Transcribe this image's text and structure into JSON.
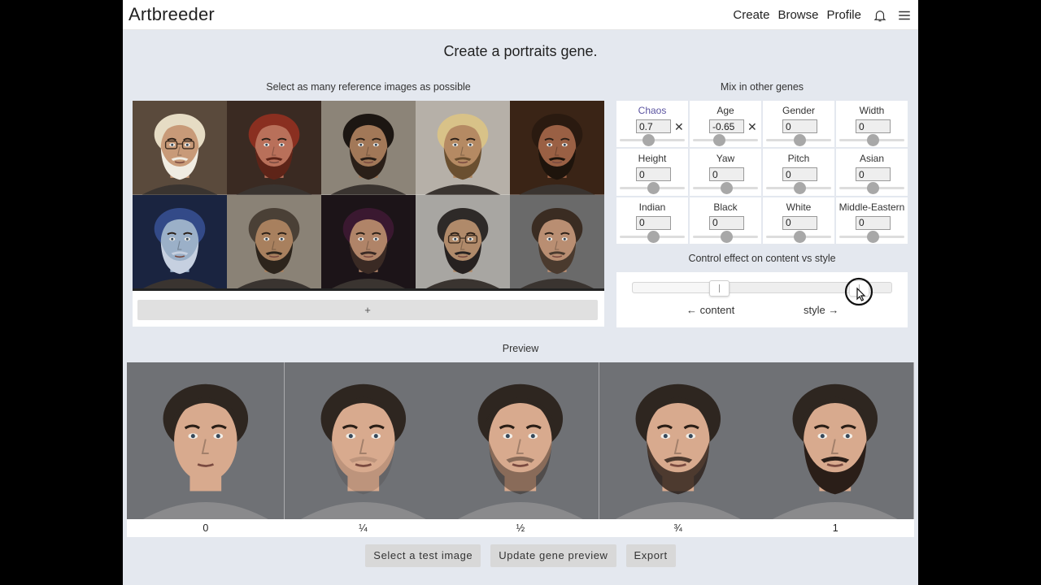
{
  "app": {
    "brand": "Artbreeder"
  },
  "nav": {
    "create": "Create",
    "browse": "Browse",
    "profile": "Profile"
  },
  "page": {
    "title": "Create a portraits gene.",
    "reference_label": "Select as many reference images as possible",
    "mix_label": "Mix in other genes",
    "effect_label": "Control effect on content vs style",
    "preview_label": "Preview"
  },
  "references": {
    "add_label": "+",
    "images": [
      {
        "skin": "#c89a78",
        "hair": "#e6dcc4",
        "beard": "#f0ece2",
        "bg": "#5a4a3c",
        "glasses": true
      },
      {
        "skin": "#b9705a",
        "hair": "#8a2f20",
        "beard": "#5e2418",
        "bg": "#3a2a22",
        "glasses": false
      },
      {
        "skin": "#a27858",
        "hair": "#1c1612",
        "beard": "#2a1f18",
        "bg": "#8c8478",
        "glasses": false
      },
      {
        "skin": "#b58a63",
        "hair": "#d8c288",
        "beard": "#6a4f30",
        "bg": "#b6b0a8",
        "glasses": false
      },
      {
        "skin": "#9a6044",
        "hair": "#2a1a10",
        "beard": "#1e140c",
        "bg": "#3a2416",
        "glasses": false
      },
      {
        "skin": "#9bb0c8",
        "hair": "#334a88",
        "beard": "#c6d0e0",
        "bg": "#1a2440",
        "glasses": false
      },
      {
        "skin": "#a8805e",
        "hair": "#4a4036",
        "beard": "#2c241c",
        "bg": "#8a8276",
        "glasses": false
      },
      {
        "skin": "#b08468",
        "hair": "#3a1830",
        "beard": "#3a2a24",
        "bg": "#1c1418",
        "glasses": false
      },
      {
        "skin": "#b08a6a",
        "hair": "#2e2a28",
        "beard": "#262120",
        "bg": "#a8a6a2",
        "glasses": true
      },
      {
        "skin": "#b98e72",
        "hair": "#3a2c22",
        "beard": "#4a3a2e",
        "bg": "#6a6a6a",
        "glasses": false
      }
    ]
  },
  "genes": [
    {
      "name": "Chaos",
      "value": "0.7",
      "active": true,
      "clearable": true,
      "level": 0.42
    },
    {
      "name": "Age",
      "value": "-0.65",
      "active": false,
      "clearable": true,
      "level": 0.38
    },
    {
      "name": "Gender",
      "value": "0",
      "active": false,
      "clearable": false,
      "level": 0.5
    },
    {
      "name": "Width",
      "value": "0",
      "active": false,
      "clearable": false,
      "level": 0.5
    },
    {
      "name": "Height",
      "value": "0",
      "active": false,
      "clearable": false,
      "level": 0.5
    },
    {
      "name": "Yaw",
      "value": "0",
      "active": false,
      "clearable": false,
      "level": 0.5
    },
    {
      "name": "Pitch",
      "value": "0",
      "active": false,
      "clearable": false,
      "level": 0.5
    },
    {
      "name": "Asian",
      "value": "0",
      "active": false,
      "clearable": false,
      "level": 0.5
    },
    {
      "name": "Indian",
      "value": "0",
      "active": false,
      "clearable": false,
      "level": 0.5
    },
    {
      "name": "Black",
      "value": "0",
      "active": false,
      "clearable": false,
      "level": 0.5
    },
    {
      "name": "White",
      "value": "0",
      "active": false,
      "clearable": false,
      "level": 0.5
    },
    {
      "name": "Middle-Eastern",
      "value": "0",
      "active": false,
      "clearable": false,
      "level": 0.5
    }
  ],
  "effect": {
    "content_label": "← content",
    "style_label": "style →",
    "start": 0.33,
    "end": 0.87
  },
  "preview": {
    "items": [
      {
        "label": "0",
        "beard": 0.0
      },
      {
        "label": "¼",
        "beard": 0.15
      },
      {
        "label": "½",
        "beard": 0.45
      },
      {
        "label": "¾",
        "beard": 0.8
      },
      {
        "label": "1",
        "beard": 1.0
      }
    ]
  },
  "actions": {
    "test_image": "Select a test image",
    "update_preview": "Update gene preview",
    "export": "Export"
  },
  "colors": {
    "active_gene": "#5a53a0",
    "panel_bg": "#e4e8ef",
    "button_bg": "#d8d8d8"
  }
}
